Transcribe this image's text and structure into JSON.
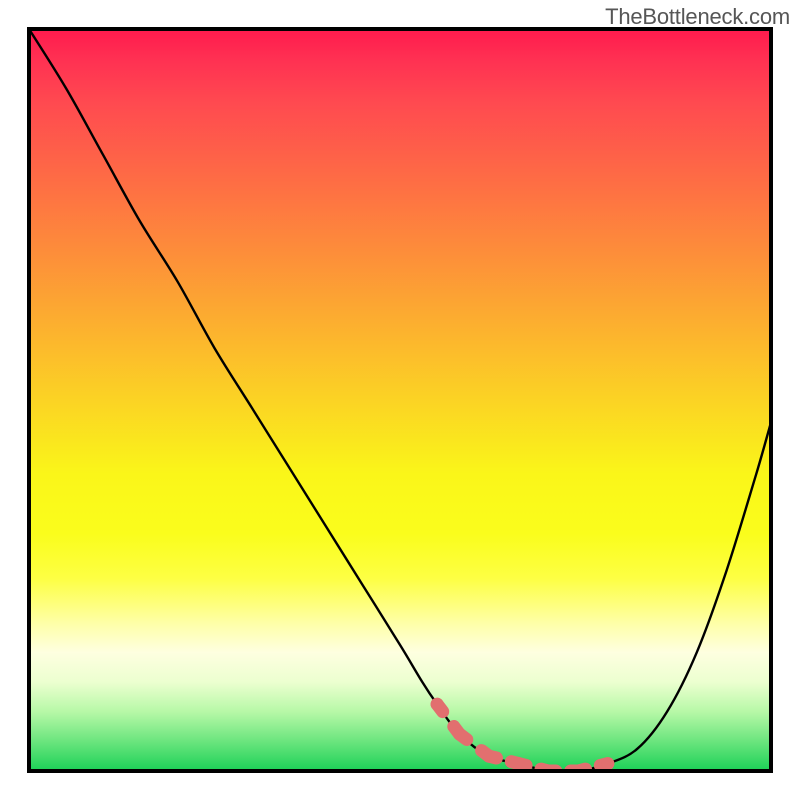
{
  "attribution": "TheBottleneck.com",
  "chart_data": {
    "type": "line",
    "title": "",
    "xlabel": "",
    "ylabel": "",
    "xlim": [
      0,
      100
    ],
    "ylim": [
      0,
      100
    ],
    "grid": false,
    "legend": false,
    "annotations": [],
    "background_gradient": {
      "direction": "vertical",
      "stops": [
        {
          "pos": 0.0,
          "color": "#ff1a4d",
          "meaning": "high-bottleneck"
        },
        {
          "pos": 0.5,
          "color": "#fbd324",
          "meaning": "mid"
        },
        {
          "pos": 1.0,
          "color": "#1bd157",
          "meaning": "no-bottleneck"
        }
      ]
    },
    "series": [
      {
        "name": "bottleneck-curve",
        "color": "#000000",
        "x": [
          0,
          5,
          10,
          15,
          20,
          25,
          30,
          35,
          40,
          45,
          50,
          53,
          55,
          58,
          62,
          66,
          70,
          74,
          78,
          82,
          86,
          90,
          94,
          98,
          100
        ],
        "y": [
          100,
          92,
          83,
          74,
          66,
          57,
          49,
          41,
          33,
          25,
          17,
          12,
          9,
          5,
          2,
          1,
          0,
          0,
          1,
          3,
          8,
          16,
          27,
          40,
          47
        ]
      },
      {
        "name": "optimal-range-marker",
        "color": "#e26f6f",
        "style": "thick-dashed",
        "x": [
          55,
          58,
          62,
          66,
          70,
          74,
          78
        ],
        "y": [
          9,
          5,
          2,
          1,
          0,
          0,
          1
        ]
      }
    ]
  }
}
